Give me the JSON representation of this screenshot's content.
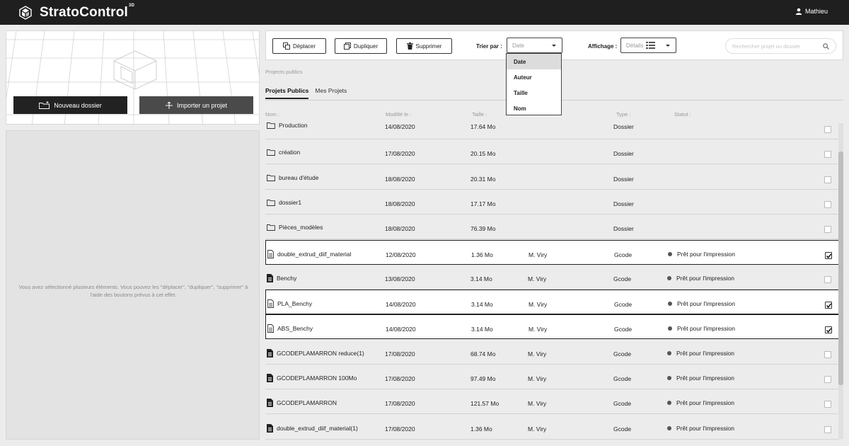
{
  "app": {
    "title": "StratoControl",
    "title_sup": "3D",
    "user": "Mathieu"
  },
  "left": {
    "new_folder_label": "Nouveau dossier",
    "import_label": "Importer un projet",
    "selection_message": "Vous avez sélectionné plusieurs éléments. Vous pouvez les \"déplacer\", \"dupliquer\", \"supprimer\" à l'aide des boutons prévus à cet effet."
  },
  "toolbar": {
    "move_label": "Déplacer",
    "duplicate_label": "Dupliquer",
    "delete_label": "Supprimer",
    "sort_label": "Trier par :",
    "sort_value": "Date",
    "display_label": "Affichage :",
    "display_value": "Détails",
    "search_placeholder": "Rechercher projet ou dossier"
  },
  "sort_options": [
    "Date",
    "Auteur",
    "Taille",
    "Nom"
  ],
  "breadcrumb": "Projects publics",
  "tabs": [
    "Projets Publics",
    "Mes Projets"
  ],
  "columns": {
    "name": "Nom :",
    "modified": "Modifié le :",
    "size": "Taille :",
    "type": "Type :",
    "status": "Statut :"
  },
  "rows": [
    {
      "name": "Production",
      "date": "14/08/2020",
      "size": "17.64 Mo",
      "author": "",
      "type": "Dossier",
      "status": "",
      "kind": "folder",
      "checked": false
    },
    {
      "name": "création",
      "date": "17/08/2020",
      "size": "20.15 Mo",
      "author": "",
      "type": "Dossier",
      "status": "",
      "kind": "folder",
      "checked": false
    },
    {
      "name": "bureau d'étude",
      "date": "18/08/2020",
      "size": "20.31 Mo",
      "author": "",
      "type": "Dossier",
      "status": "",
      "kind": "folder",
      "checked": false
    },
    {
      "name": "dossier1",
      "date": "18/08/2020",
      "size": "17.17 Mo",
      "author": "",
      "type": "Dossier",
      "status": "",
      "kind": "folder",
      "checked": false
    },
    {
      "name": "Pièces_modèles",
      "date": "18/08/2020",
      "size": "76.39 Mo",
      "author": "",
      "type": "Dossier",
      "status": "",
      "kind": "folder",
      "checked": false
    },
    {
      "name": "double_extrud_diif_material",
      "date": "12/08/2020",
      "size": "1.36 Mo",
      "author": "M. Viry",
      "type": "Gcode",
      "status": "Prêt pour l'impression",
      "kind": "file-outline",
      "checked": true
    },
    {
      "name": "Benchy",
      "date": "13/08/2020",
      "size": "3.14 Mo",
      "author": "M. Viry",
      "type": "Gcode",
      "status": "Prêt pour l'impression",
      "kind": "file",
      "checked": false
    },
    {
      "name": "PLA_Benchy",
      "date": "14/08/2020",
      "size": "3.14 Mo",
      "author": "M. Viry",
      "type": "Gcode",
      "status": "Prêt pour l'impression",
      "kind": "file-outline",
      "checked": true
    },
    {
      "name": "ABS_Benchy",
      "date": "14/08/2020",
      "size": "3.14 Mo",
      "author": "M. Viry",
      "type": "Gcode",
      "status": "Prêt pour l'impression",
      "kind": "file-outline",
      "checked": true
    },
    {
      "name": "GCODEPLAMARRON reduce(1)",
      "date": "17/08/2020",
      "size": "68.74 Mo",
      "author": "M. Viry",
      "type": "Gcode",
      "status": "Prêt pour l'impression",
      "kind": "file",
      "checked": false
    },
    {
      "name": "GCODEPLAMARRON 100Mo",
      "date": "17/08/2020",
      "size": "97.49 Mo",
      "author": "M. Viry",
      "type": "Gcode",
      "status": "Prêt pour l'impression",
      "kind": "file",
      "checked": false
    },
    {
      "name": "GCODEPLAMARRON",
      "date": "17/08/2020",
      "size": "121.57 Mo",
      "author": "M. Viry",
      "type": "Gcode",
      "status": "Prêt pour l'impression",
      "kind": "file",
      "checked": false
    },
    {
      "name": "double_extrud_diif_material(1)",
      "date": "17/08/2020",
      "size": "1.36 Mo",
      "author": "M. Viry",
      "type": "Gcode",
      "status": "Prêt pour l'impression",
      "kind": "file",
      "checked": false
    }
  ]
}
